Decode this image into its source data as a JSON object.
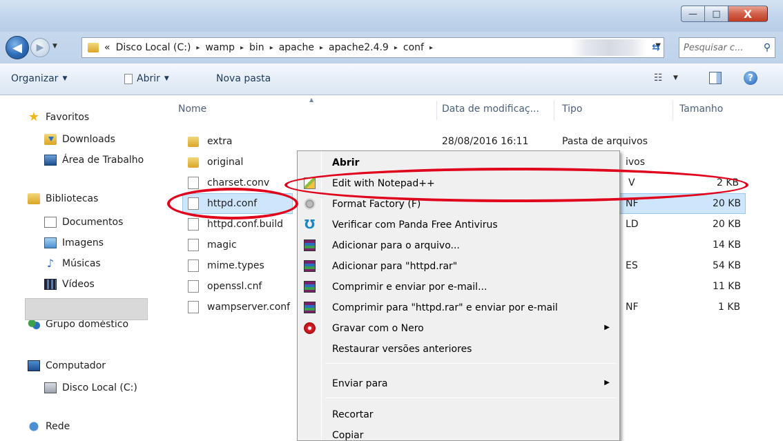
{
  "window": {
    "controls": {
      "minimize": "—",
      "maximize": "□",
      "close": "X"
    }
  },
  "address": {
    "prefix": "«",
    "breadcrumbs": [
      "Disco Local (C:)",
      "wamp",
      "bin",
      "apache",
      "apache2.4.9",
      "conf"
    ],
    "separator": "▸"
  },
  "search": {
    "placeholder": "Pesquisar c..."
  },
  "commandbar": {
    "organize": "Organizar",
    "open": "Abrir",
    "new_folder": "Nova pasta"
  },
  "navpane": {
    "favorites": "Favoritos",
    "downloads": "Downloads",
    "desktop": "Área de Trabalho",
    "libraries": "Bibliotecas",
    "documents": "Documentos",
    "images": "Imagens",
    "music": "Músicas",
    "videos": "Vídeos",
    "homegroup": "Grupo doméstico",
    "computer": "Computador",
    "local_disk": "Disco Local (C:)",
    "network": "Rede"
  },
  "columns": {
    "name": "Nome",
    "date": "Data de modificaç...",
    "type": "Tipo",
    "size": "Tamanho"
  },
  "files": [
    {
      "name": "extra",
      "kind": "folder",
      "date": "28/08/2016 16:11",
      "type": "Pasta de arquivos",
      "size": ""
    },
    {
      "name": "original",
      "kind": "folder",
      "date": "",
      "type": "ivos",
      "size": ""
    },
    {
      "name": "charset.conv",
      "kind": "file",
      "date": "",
      "type": "V",
      "size": "2 KB"
    },
    {
      "name": "httpd.conf",
      "kind": "file",
      "date": "",
      "type": "NF",
      "size": "20 KB"
    },
    {
      "name": "httpd.conf.build",
      "kind": "file",
      "date": "",
      "type": "LD",
      "size": "20 KB"
    },
    {
      "name": "magic",
      "kind": "file",
      "date": "",
      "type": "",
      "size": "14 KB"
    },
    {
      "name": "mime.types",
      "kind": "file",
      "date": "",
      "type": "ES",
      "size": "54 KB"
    },
    {
      "name": "openssl.cnf",
      "kind": "file",
      "date": "",
      "type": "",
      "size": "11 KB"
    },
    {
      "name": "wampserver.conf",
      "kind": "file",
      "date": "",
      "type": "NF",
      "size": "1 KB"
    }
  ],
  "contextmenu": {
    "open": "Abrir",
    "notepad": "Edit with Notepad++",
    "format_factory": "Format Factory (F)",
    "panda": "Verificar com Panda Free Antivirus",
    "add_archive": "Adicionar para o arquivo...",
    "add_rar": "Adicionar para \"httpd.rar\"",
    "compress_email": "Comprimir e enviar por e-mail...",
    "compress_rar_email": "Comprimir para \"httpd.rar\" e enviar por e-mail",
    "nero": "Gravar com o Nero",
    "restore": "Restaurar versões anteriores",
    "send_to": "Enviar para",
    "cut": "Recortar",
    "copy": "Copiar"
  },
  "colors": {
    "annotation": "#e0001b",
    "selection": "#cde6fb",
    "menu_bg": "#f0f0f0"
  }
}
